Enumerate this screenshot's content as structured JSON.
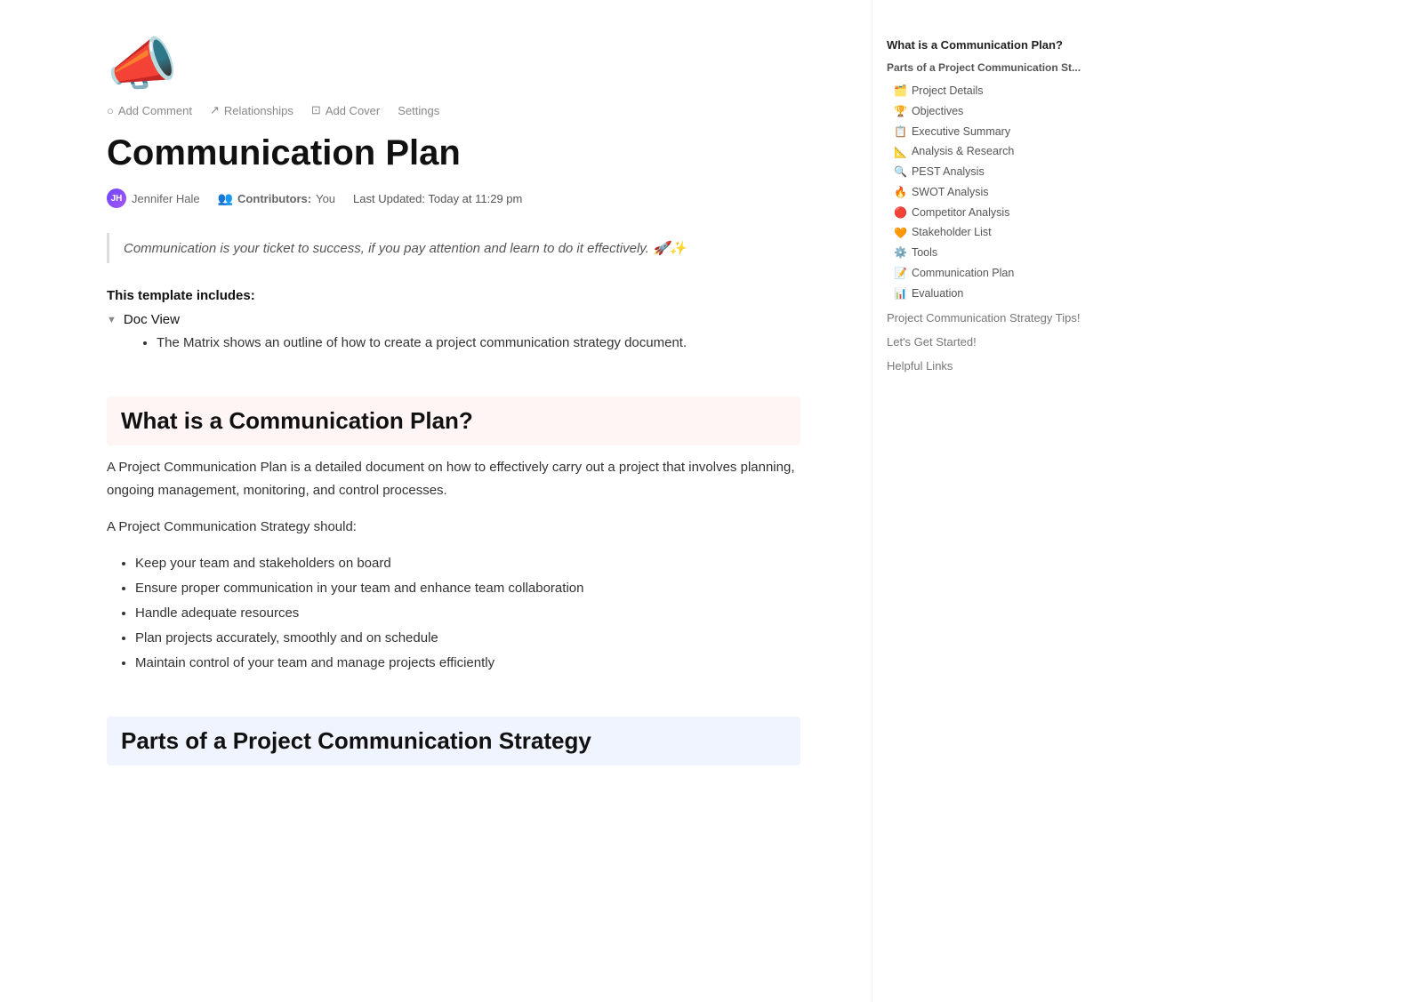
{
  "page": {
    "icon": "📣",
    "title": "Communication Plan",
    "toolbar": {
      "comment_label": "Add Comment",
      "relationships_label": "Relationships",
      "cover_label": "Add Cover",
      "settings_label": "Settings"
    },
    "author_name": "Jennifer Hale",
    "contributors_label": "Contributors:",
    "contributors_value": "You",
    "last_updated_label": "Last Updated:",
    "last_updated_value": "Today at 11:29 pm",
    "quote": "Communication is your ticket to success, if you pay attention and learn to do it effectively. 🚀✨",
    "template_includes_label": "This template includes:",
    "toggle_label": "Doc View",
    "toggle_sub": "The Matrix shows an outline of how to create a project communication strategy document.",
    "section1": {
      "heading": "What is a Communication Plan?",
      "body1": "A Project Communication Plan is a detailed document on how to effectively carry out a project that involves planning, ongoing management, monitoring, and control processes.",
      "body2": "A Project Communication Strategy should:",
      "bullets": [
        "Keep your team and stakeholders on board",
        "Ensure proper communication in your team and enhance team collaboration",
        "Handle adequate resources",
        "Plan projects accurately, smoothly and on schedule",
        "Maintain control of your team and manage projects efficiently"
      ]
    },
    "section2": {
      "heading": "Parts of a Project Communication Strategy"
    }
  },
  "toc": {
    "link1": "What is a Communication Plan?",
    "sub_heading": "Parts of a Project Communication St...",
    "sub_items": [
      {
        "emoji": "🗂️",
        "label": "Project Details"
      },
      {
        "emoji": "🏆",
        "label": "Objectives"
      },
      {
        "emoji": "📋",
        "label": "Executive Summary"
      },
      {
        "emoji": "📐",
        "label": "Analysis & Research"
      },
      {
        "emoji": "🔍",
        "label": "PEST Analysis"
      },
      {
        "emoji": "🔥",
        "label": "SWOT Analysis"
      },
      {
        "emoji": "🔴",
        "label": "Competitor Analysis"
      },
      {
        "emoji": "🧡",
        "label": "Stakeholder List"
      },
      {
        "emoji": "⚙️",
        "label": "Tools"
      },
      {
        "emoji": "📝",
        "label": "Communication Plan"
      },
      {
        "emoji": "📊",
        "label": "Evaluation"
      }
    ],
    "link2": "Project Communication Strategy Tips!",
    "link3": "Let's Get Started!",
    "link4": "Helpful Links"
  }
}
